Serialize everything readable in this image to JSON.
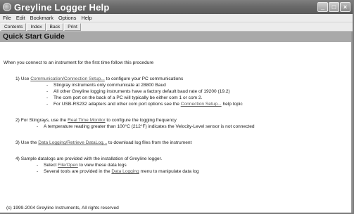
{
  "window": {
    "title": "Greyline Logger Help",
    "buttons": {
      "minimize": "_",
      "maximize": "□",
      "close": "×"
    }
  },
  "menu": {
    "items": [
      "File",
      "Edit",
      "Bookmark",
      "Options",
      "Help"
    ]
  },
  "toolbar": {
    "items": [
      "Contents",
      "Index",
      "Back",
      "Print"
    ]
  },
  "header": {
    "title": "Quick Start Guide"
  },
  "content": {
    "intro": "When you connect to an instrument for the first time follow this procedure",
    "step1": {
      "num": "1)",
      "pre": "Use ",
      "link": "Communication/Connection Setup...",
      "post": " to configure your PC communications",
      "bullets": [
        "Stingray instruments only communicate at 28800 Baud",
        "All other Greyline logging instruments have a factory default baud rate of 19200 (19.2)",
        "The com port on the back of a PC will typically be either com 1 or com 2."
      ],
      "bullet4_pre": "For USB-RS232 adapters and other com port options see the ",
      "bullet4_link": "Connection Setup...",
      "bullet4_post": " help topic"
    },
    "step2": {
      "num": "2)",
      "pre": "For Stingrays,  use the ",
      "link": "Real Time Monitor",
      "post": " to configure the logging frequency",
      "bullet": "A temperature reading greater than 100°C (212°F) indicates the Velocity-Level sensor is not connected"
    },
    "step3": {
      "num": "3)",
      "pre": "Use the ",
      "link": "Data Logging/Retrieve DataLog...",
      "post": " to download log files from the instrument"
    },
    "step4": {
      "num": "4)",
      "text": "Sample datalogs are provided with the installation of Greyline logger.",
      "b1_pre": "Select ",
      "b1_link": "File/Open",
      "b1_post": " to view these data logs",
      "b2_pre": "Several tools are provided in the ",
      "b2_link": "Data Logging",
      "b2_post": " menu to manipulate data log"
    },
    "dash": "-",
    "copyright": "(c) 1999-2004 Greyline Instruments, All rights reserved"
  }
}
